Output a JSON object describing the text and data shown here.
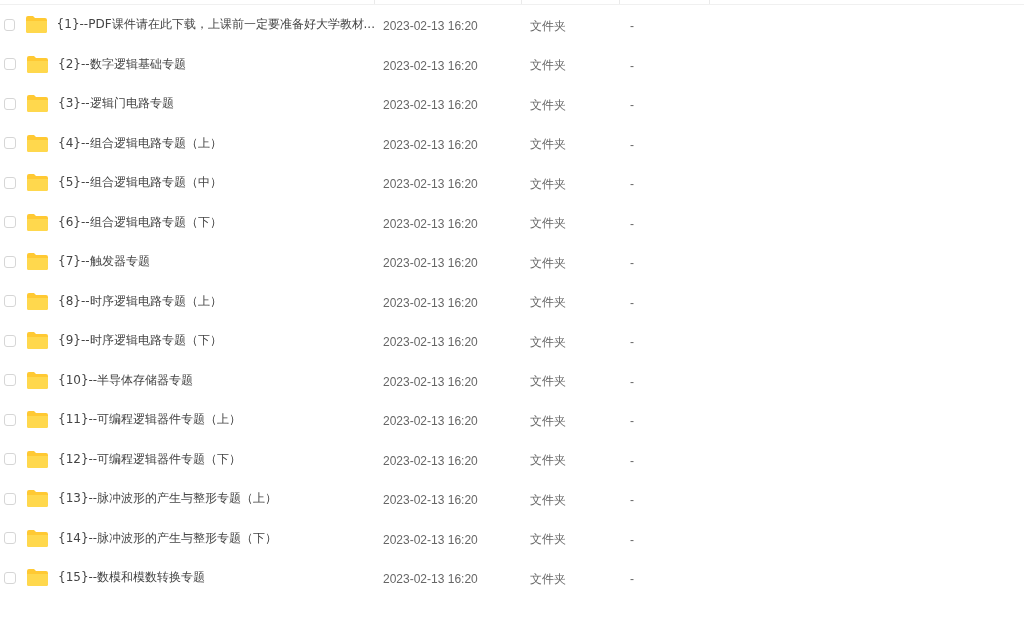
{
  "rows": [
    {
      "checked": false,
      "name": "{1}--PDF课件请在此下载，上课前一定要准备好大学教材...",
      "modified": "2023-02-13 16:20",
      "type": "文件夹",
      "size": "-"
    },
    {
      "checked": false,
      "name": "{2}--数字逻辑基础专题",
      "modified": "2023-02-13 16:20",
      "type": "文件夹",
      "size": "-"
    },
    {
      "checked": false,
      "name": "{3}--逻辑门电路专题",
      "modified": "2023-02-13 16:20",
      "type": "文件夹",
      "size": "-"
    },
    {
      "checked": false,
      "name": "{4}--组合逻辑电路专题（上）",
      "modified": "2023-02-13 16:20",
      "type": "文件夹",
      "size": "-"
    },
    {
      "checked": false,
      "name": "{5}--组合逻辑电路专题（中）",
      "modified": "2023-02-13 16:20",
      "type": "文件夹",
      "size": "-"
    },
    {
      "checked": false,
      "name": "{6}--组合逻辑电路专题（下）",
      "modified": "2023-02-13 16:20",
      "type": "文件夹",
      "size": "-"
    },
    {
      "checked": false,
      "name": "{7}--触发器专题",
      "modified": "2023-02-13 16:20",
      "type": "文件夹",
      "size": "-"
    },
    {
      "checked": false,
      "name": "{8}--时序逻辑电路专题（上）",
      "modified": "2023-02-13 16:20",
      "type": "文件夹",
      "size": "-"
    },
    {
      "checked": false,
      "name": "{9}--时序逻辑电路专题（下）",
      "modified": "2023-02-13 16:20",
      "type": "文件夹",
      "size": "-"
    },
    {
      "checked": false,
      "name": "{10}--半导体存储器专题",
      "modified": "2023-02-13 16:20",
      "type": "文件夹",
      "size": "-"
    },
    {
      "checked": false,
      "name": "{11}--可编程逻辑器件专题（上）",
      "modified": "2023-02-13 16:20",
      "type": "文件夹",
      "size": "-"
    },
    {
      "checked": false,
      "name": "{12}--可编程逻辑器件专题（下）",
      "modified": "2023-02-13 16:20",
      "type": "文件夹",
      "size": "-"
    },
    {
      "checked": false,
      "name": "{13}--脉冲波形的产生与整形专题（上）",
      "modified": "2023-02-13 16:20",
      "type": "文件夹",
      "size": "-"
    },
    {
      "checked": false,
      "name": "{14}--脉冲波形的产生与整形专题（下）",
      "modified": "2023-02-13 16:20",
      "type": "文件夹",
      "size": "-"
    },
    {
      "checked": false,
      "name": "{15}--数模和模数转换专题",
      "modified": "2023-02-13 16:20",
      "type": "文件夹",
      "size": "-"
    }
  ]
}
